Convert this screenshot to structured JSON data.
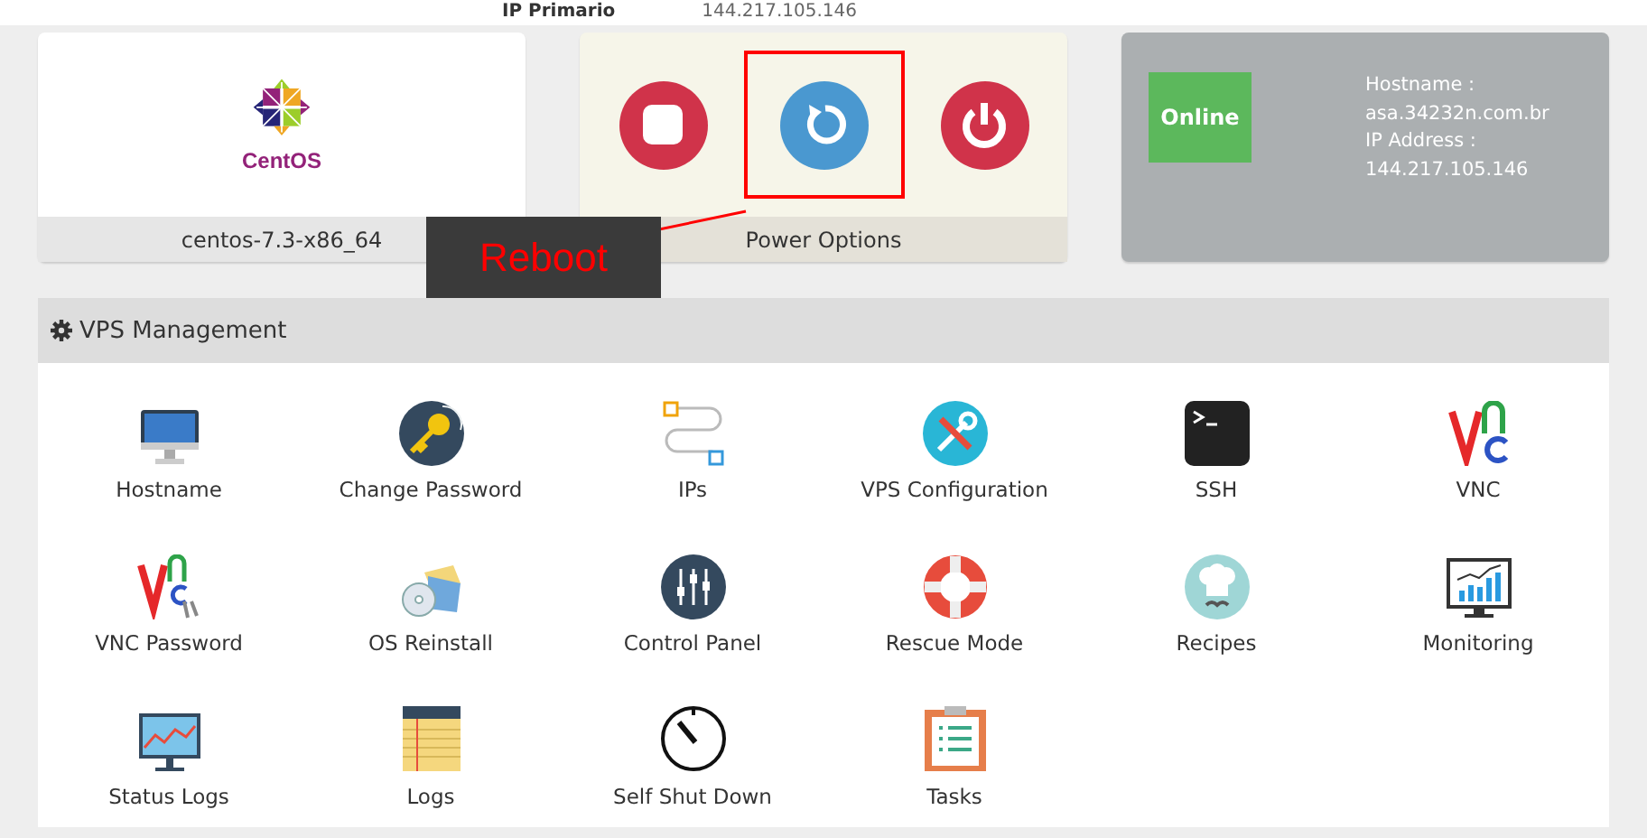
{
  "top_strip": {
    "label": "IP Primario",
    "value": "144.217.105.146"
  },
  "os_card": {
    "logo_text": "CentOS",
    "caption": "centos-7.3-x86_64"
  },
  "power_card": {
    "caption": "Power Options",
    "buttons": [
      {
        "kind": "stop",
        "highlighted": false
      },
      {
        "kind": "reboot",
        "highlighted": true
      },
      {
        "kind": "power",
        "highlighted": false
      }
    ],
    "tooltip": "Reboot"
  },
  "status_card": {
    "status": "Online",
    "lines": [
      "Hostname :",
      "asa.34232n.com.br",
      "IP Address :",
      "144.217.105.146"
    ]
  },
  "panel": {
    "title": "VPS Management",
    "items": [
      {
        "label": "Hostname"
      },
      {
        "label": "Change Password"
      },
      {
        "label": "IPs"
      },
      {
        "label": "VPS Configuration"
      },
      {
        "label": "SSH"
      },
      {
        "label": "VNC"
      },
      {
        "label": "VNC Password"
      },
      {
        "label": "OS Reinstall"
      },
      {
        "label": "Control Panel"
      },
      {
        "label": "Rescue Mode"
      },
      {
        "label": "Recipes"
      },
      {
        "label": "Monitoring"
      },
      {
        "label": "Status Logs"
      },
      {
        "label": "Logs"
      },
      {
        "label": "Self Shut Down"
      },
      {
        "label": "Tasks"
      }
    ]
  }
}
